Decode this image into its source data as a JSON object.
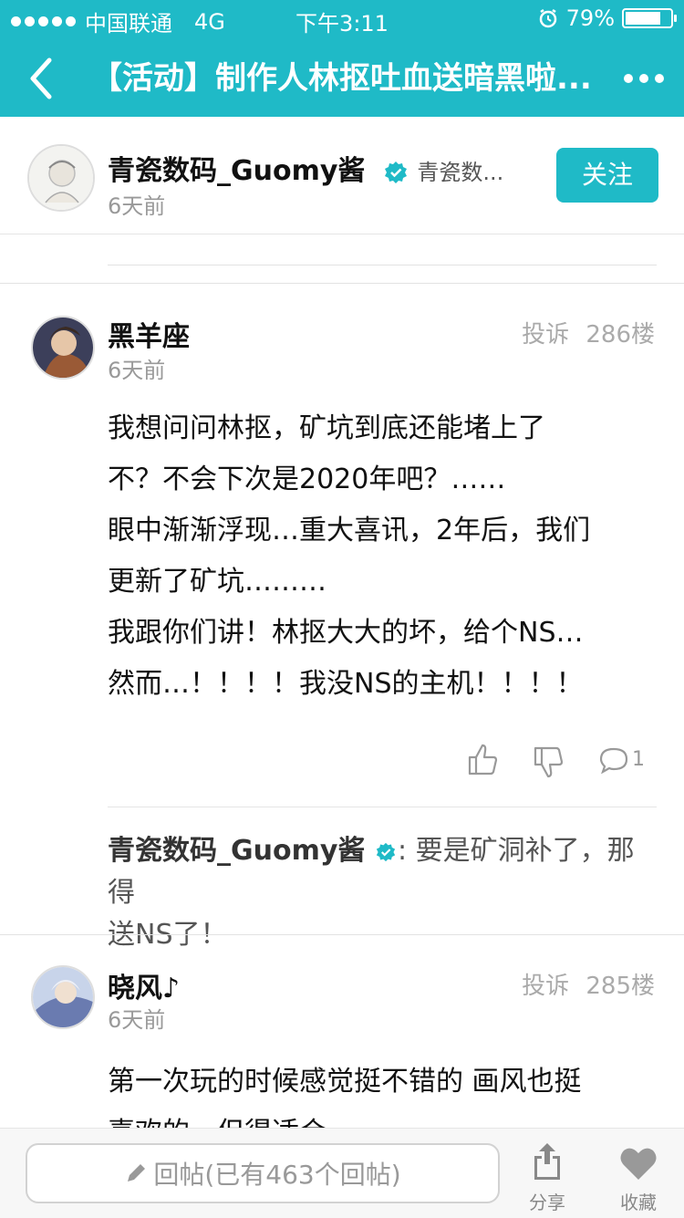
{
  "status": {
    "carrier": "中国联通",
    "network": "4G",
    "time": "下午3:11",
    "battery": "79%",
    "battery_level": 0.79
  },
  "nav": {
    "title": "【活动】制作人林抠吐血送暗黑啦..."
  },
  "author": {
    "name": "青瓷数码_Guomy酱",
    "tag": "青瓷数...",
    "time": "6天前",
    "follow_label": "关注"
  },
  "posts": [
    {
      "user": "黑羊座",
      "time": "6天前",
      "report": "投诉",
      "floor": "286楼",
      "content": [
        "我想问问林抠，矿坑到底还能堵上了",
        "不？不会下次是2020年吧？……",
        "眼中渐渐浮现…重大喜讯，2年后，我们",
        "更新了矿坑………",
        "我跟你们讲！林抠大大的坏，给个NS…",
        "然而…！！！！我没NS的主机！！！！"
      ],
      "comment_count": "1",
      "reply": {
        "author": "青瓷数码_Guomy酱",
        "text_line1": ": 要是矿洞补了，那得",
        "text_line2": "送NS了！"
      }
    },
    {
      "user": "晓风♪",
      "time": "6天前",
      "report": "投诉",
      "floor": "285楼",
      "content": [
        "第一次玩的时候感觉挺不错的 画风也挺",
        "喜欢的，但得适合"
      ]
    }
  ],
  "bottom": {
    "reply_placeholder": "回帖(已有463个回帖)",
    "share_label": "分享",
    "fav_label": "收藏"
  },
  "colors": {
    "accent": "#1fbac7"
  }
}
